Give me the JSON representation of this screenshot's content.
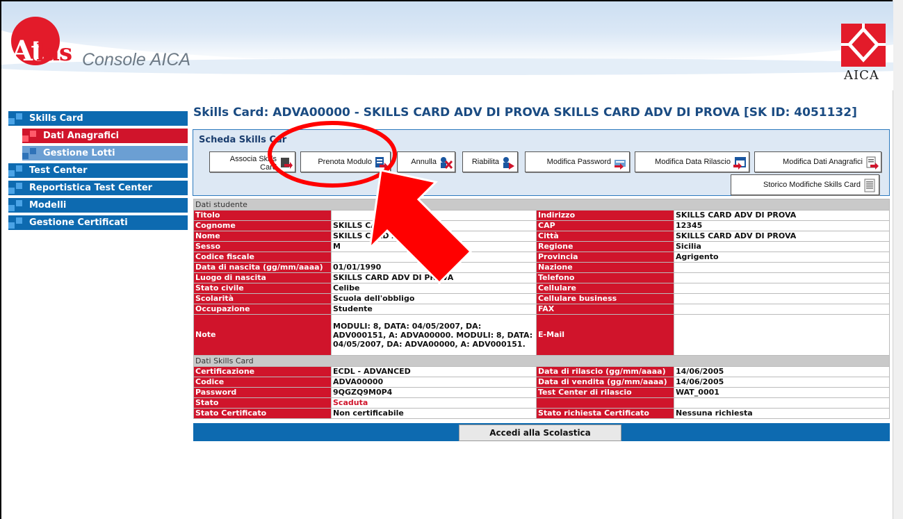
{
  "logo": {
    "brand_at": "At",
    "brand_las": "las",
    "product": "Console AICA",
    "partner": "AICA"
  },
  "sidebar": {
    "items": [
      {
        "label": "Skills Card"
      },
      {
        "label": "Dati Anagrafici"
      },
      {
        "label": "Gestione Lotti"
      },
      {
        "label": "Test Center"
      },
      {
        "label": "Reportistica Test Center"
      },
      {
        "label": "Modelli"
      },
      {
        "label": "Gestione Certificati"
      }
    ]
  },
  "page": {
    "title": "Skills Card: ADVA00000 - SKILLS CARD ADV DI PROVA SKILLS CARD ADV DI PROVA [SK ID: 4051132]"
  },
  "scheda": {
    "title": "Scheda Skills Car",
    "buttons": [
      {
        "label": "Associa Skills Card"
      },
      {
        "label": "Prenota Modulo"
      },
      {
        "label": "Annulla"
      },
      {
        "label": "Riabilita"
      },
      {
        "label": "Modifica Password"
      },
      {
        "label": "Modifica Data Rilascio"
      },
      {
        "label": "Modifica Dati Anagrafici"
      },
      {
        "label": "Storico Modifiche Skills Card"
      }
    ]
  },
  "studente": {
    "section": "Dati studente",
    "left": [
      {
        "label": "Titolo",
        "value": ""
      },
      {
        "label": "Cognome",
        "value": "SKILLS CARD ADV"
      },
      {
        "label": "Nome",
        "value": "SKILLS CARD ADV D"
      },
      {
        "label": "Sesso",
        "value": "M"
      },
      {
        "label": "Codice fiscale",
        "value": ""
      },
      {
        "label": "Data di nascita (gg/mm/aaaa)",
        "value": "01/01/1990"
      },
      {
        "label": "Luogo di nascita",
        "value": "SKILLS CARD ADV DI PROVA"
      },
      {
        "label": "Stato civile",
        "value": "Celibe"
      },
      {
        "label": "Scolarità",
        "value": "Scuola dell'obbligo"
      },
      {
        "label": "Occupazione",
        "value": "Studente"
      },
      {
        "label": "Note",
        "value": "MODULI: 8, DATA: 04/05/2007, DA: ADV000151, A: ADVA00000. MODULI: 8, DATA: 04/05/2007, DA: ADVA00000, A: ADV000151."
      }
    ],
    "right": [
      {
        "label": "Indirizzo",
        "value": "SKILLS CARD ADV DI PROVA"
      },
      {
        "label": "CAP",
        "value": "12345"
      },
      {
        "label": "Città",
        "value": "SKILLS CARD ADV DI PROVA"
      },
      {
        "label": "Regione",
        "value": "Sicilia"
      },
      {
        "label": "Provincia",
        "value": "Agrigento"
      },
      {
        "label": "Nazione",
        "value": ""
      },
      {
        "label": "Telefono",
        "value": ""
      },
      {
        "label": "Cellulare",
        "value": ""
      },
      {
        "label": "Cellulare business",
        "value": ""
      },
      {
        "label": "FAX",
        "value": ""
      },
      {
        "label": "E-Mail",
        "value": ""
      }
    ]
  },
  "skills": {
    "section": "Dati Skills Card",
    "left": [
      {
        "label": "Certificazione",
        "value": "ECDL - ADVANCED"
      },
      {
        "label": "Codice",
        "value": "ADVA00000"
      },
      {
        "label": "Password",
        "value": "9QGZQ9M0P4"
      },
      {
        "label": "Stato",
        "value": "Scaduta"
      },
      {
        "label": "Stato Certificato",
        "value": "Non certificabile"
      }
    ],
    "right": [
      {
        "label": "Data di rilascio (gg/mm/aaaa)",
        "value": "14/06/2005"
      },
      {
        "label": "Data di vendita (gg/mm/aaaa)",
        "value": "14/06/2005"
      },
      {
        "label": "Test Center di rilascio",
        "value": "WAT_0001"
      },
      {
        "label": "",
        "value": ""
      },
      {
        "label": "Stato richiesta Certificato",
        "value": "Nessuna richiesta"
      }
    ]
  },
  "footer": {
    "accedi": "Accedi alla Scolastica"
  },
  "colors": {
    "nav_blue": "#0d6ab0",
    "label_red": "#d0142b",
    "annotation_red": "#ff0000"
  }
}
